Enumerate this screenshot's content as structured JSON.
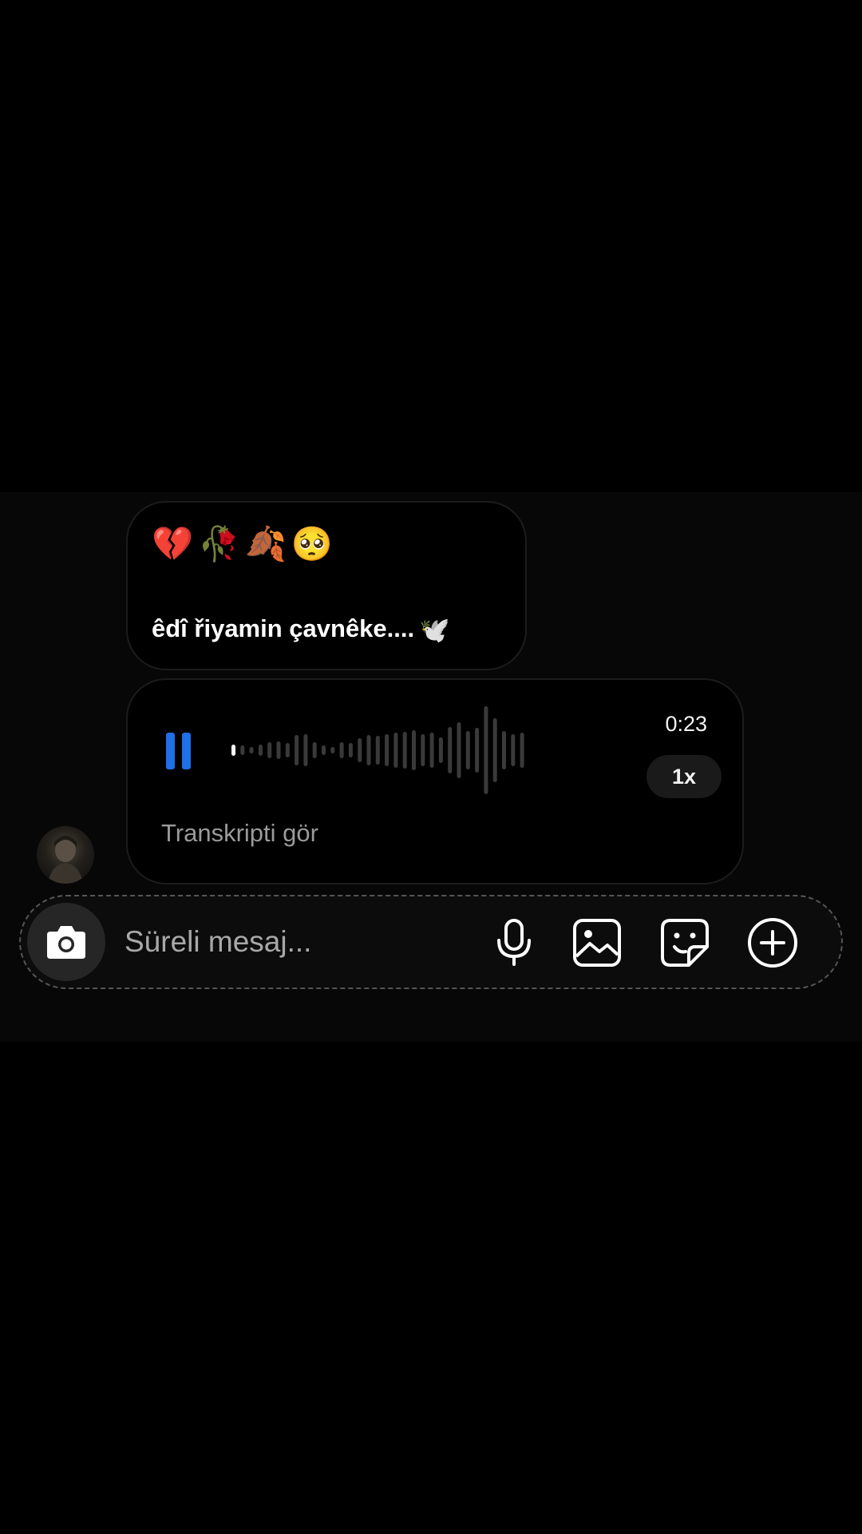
{
  "messages": {
    "text_message": {
      "emojis": "💔🥀🍂🥺",
      "text": "êdî řiyamin çavnêke....",
      "trailing_emoji": "🕊️"
    },
    "voice_message": {
      "duration": "0:23",
      "playback_speed": "1x",
      "state": "playing",
      "transcript_link": "Transkripti gör"
    }
  },
  "sender": {
    "avatar_icon": "profile-avatar"
  },
  "composer": {
    "placeholder": "Süreli mesaj...",
    "value": "",
    "icons": [
      "camera-icon",
      "microphone-icon",
      "gallery-icon",
      "sticker-icon",
      "add-icon"
    ]
  },
  "colors": {
    "accent": "#1f6fe6",
    "background": "#000000",
    "bubble_border": "#1c1c1c",
    "waveform": "#3a3a3a",
    "waveform_played": "#ffffff"
  }
}
